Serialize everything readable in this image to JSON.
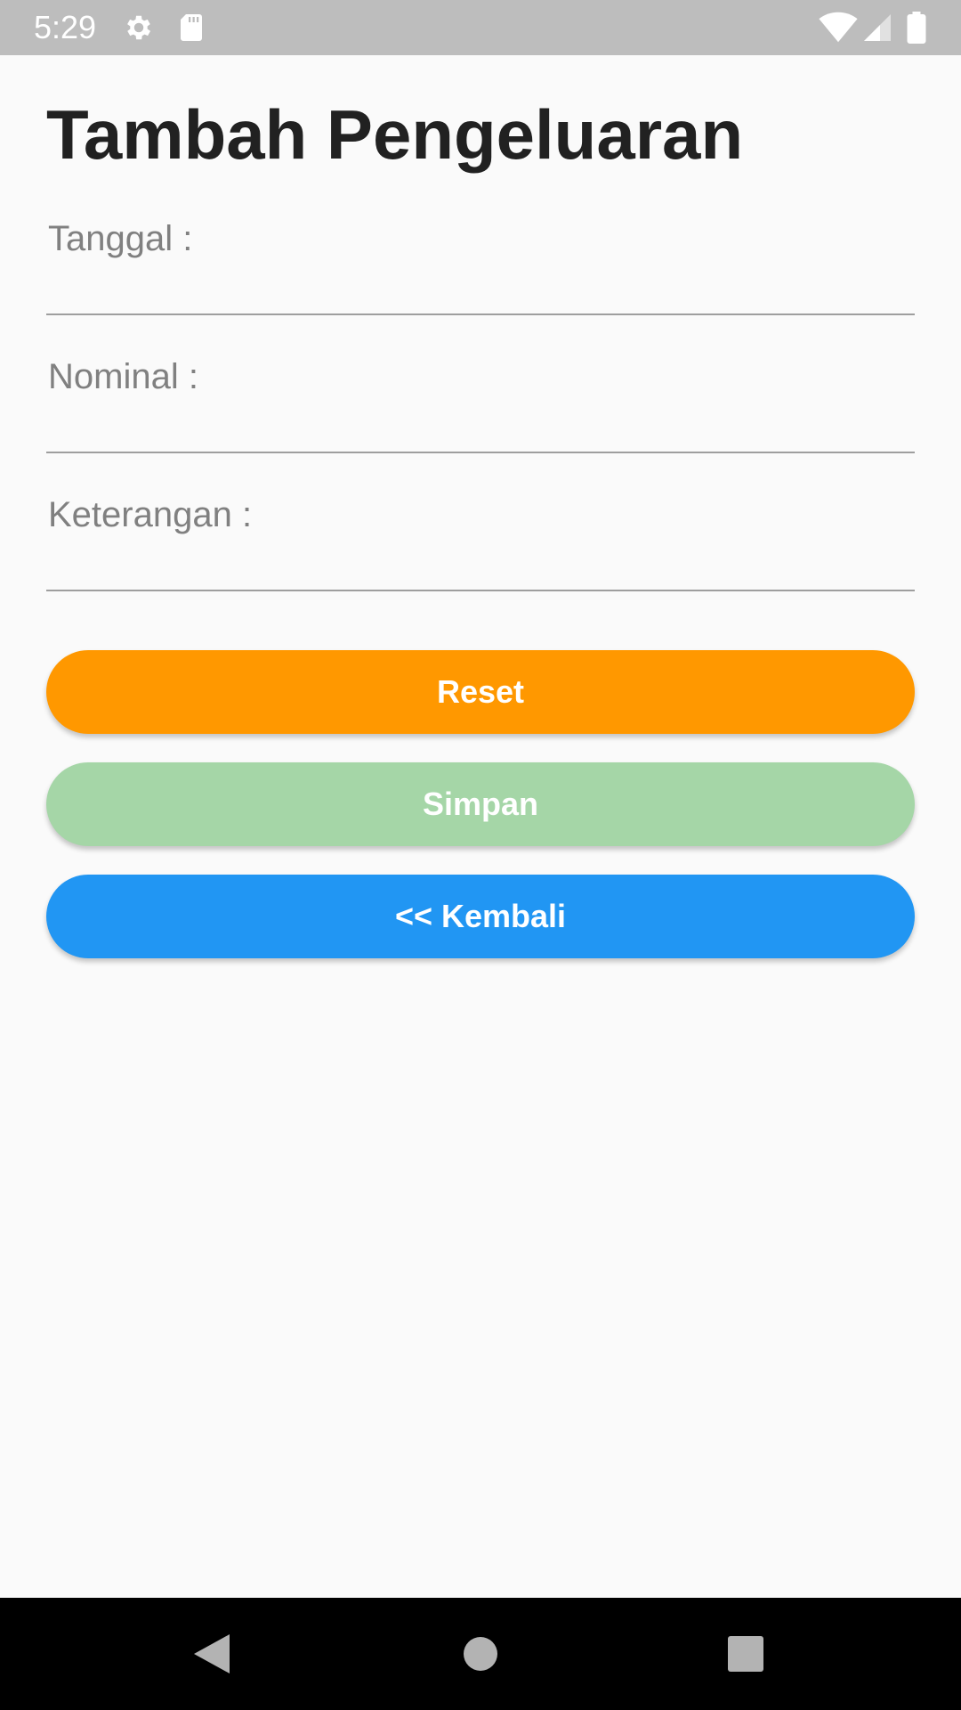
{
  "status_bar": {
    "time": "5:29",
    "icons": [
      "gear-icon",
      "sd-card-icon",
      "wifi-icon",
      "cell-signal-icon",
      "battery-icon"
    ]
  },
  "page": {
    "title": "Tambah Pengeluaran"
  },
  "form": {
    "tanggal": {
      "label": "Tanggal :",
      "value": ""
    },
    "nominal": {
      "label": "Nominal :",
      "value": ""
    },
    "keterangan": {
      "label": "Keterangan :",
      "value": ""
    }
  },
  "buttons": {
    "reset": {
      "label": "Reset",
      "color": "#ff9800"
    },
    "simpan": {
      "label": "Simpan",
      "color": "#a5d6a7"
    },
    "kembali": {
      "label": "<< Kembali",
      "color": "#2196f3"
    }
  },
  "nav_bar": {
    "icons": [
      "back-triangle-icon",
      "home-circle-icon",
      "recents-square-icon"
    ]
  }
}
